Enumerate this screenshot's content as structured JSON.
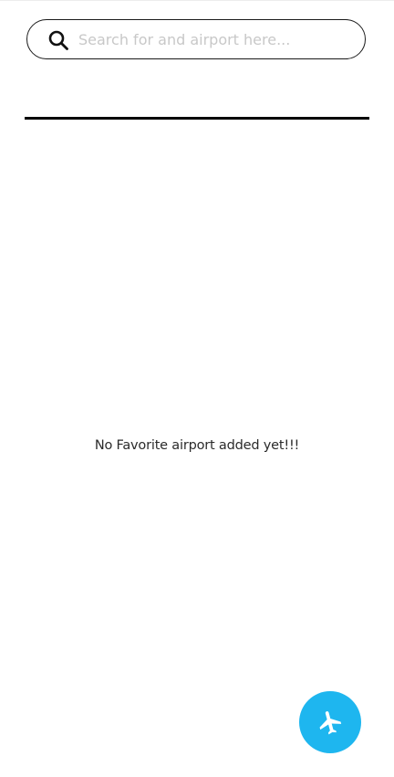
{
  "search": {
    "placeholder": "Search for and airport here...",
    "value": ""
  },
  "favorites": {
    "empty_message": "No Favorite airport added yet!!!"
  },
  "fab": {
    "icon": "airplane-icon",
    "color": "#1eb6ef"
  }
}
